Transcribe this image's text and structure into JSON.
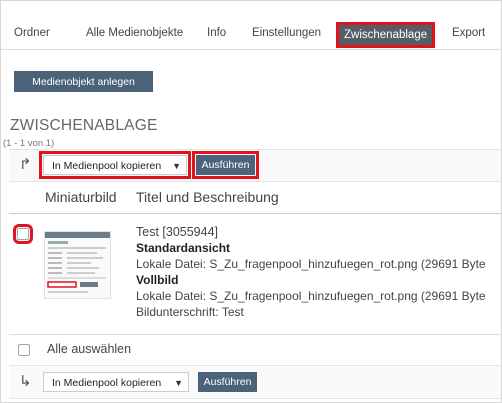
{
  "tabs": [
    {
      "label": "Ordner"
    },
    {
      "label": "Alle Medienobjekte"
    },
    {
      "label": "Info"
    },
    {
      "label": "Einstellungen"
    },
    {
      "label": "Zwischenablage"
    },
    {
      "label": "Export"
    }
  ],
  "toolbar": {
    "create_label": "Medienobjekt anlegen"
  },
  "section": {
    "title": "ZWISCHENABLAGE",
    "count": "(1 - 1 von 1)"
  },
  "actions": {
    "select_value": "In Medienpool kopieren",
    "execute_label": "Ausführen"
  },
  "table": {
    "columns": [
      "Miniaturbild",
      "Titel und Beschreibung"
    ],
    "row": {
      "title": "Test [3055944]",
      "label_standard": "Standardansicht",
      "file_standard": "Lokale Datei: S_Zu_fragenpool_hinzufuegen_rot.png (29691 Byte",
      "label_full": "Vollbild",
      "file_full": "Lokale Datei: S_Zu_fragenpool_hinzufuegen_rot.png (29691 Byte",
      "caption": "Bildunterschrift: Test"
    }
  },
  "footer": {
    "select_all": "Alle auswählen"
  },
  "colors": {
    "accent_red": "#e0141e",
    "button_blue": "#4b6379",
    "active_tab": "#555d65"
  }
}
